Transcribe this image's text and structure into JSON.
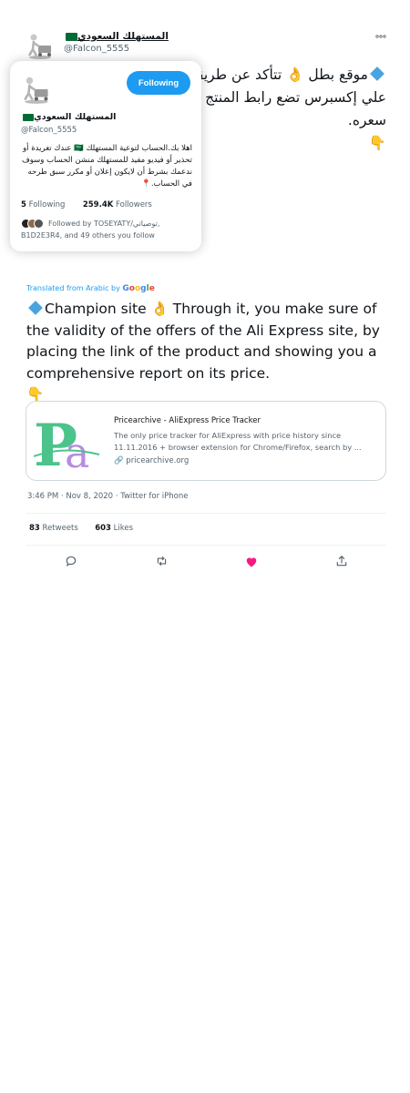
{
  "tweet": {
    "author_name": "المستهلك السعودي",
    "author_handle": "@Falcon_5555",
    "more_icon": "more-horizontal-icon",
    "text_ar_line1": "موقع بطل 👌 تتأكد عن طريقه من صحة عروض موقع",
    "text_ar_line2": "علي إكسبرس تضع رابط المنتج ويعطيك تقرير شامل عن",
    "text_ar_line3": "سعره.",
    "text_ar_emoji": "👇",
    "translated_label": "Translated from Arabic by",
    "translated_provider": "Google",
    "text_en": "Champion site 👌 Through it, you make sure of the validity of the offers of the Ali Express site, by placing the link of the product and showing you a comprehensive report on its price.",
    "text_en_emoji": "👇",
    "timestamp": "3:46 PM · Nov 8, 2020 · Twitter for iPhone",
    "retweets_count": "83",
    "retweets_label": "Retweets",
    "likes_count": "603",
    "likes_label": "Likes"
  },
  "hover_card": {
    "follow_button": "Following",
    "name": "المستهلك السعودي",
    "handle": "@Falcon_5555",
    "bio": "اهلا بك.الحساب لتوعية المستهلك 🇸🇦 عندك تغريدة أو تحذير أو فيديو مفيد للمستهلك منشن الحساب وسوف ندعمك بشرط أن لايكون إعلان أو مكرر سبق طرحه في الحساب.📍",
    "following_count": "5",
    "following_label": "Following",
    "followers_count": "259.4K",
    "followers_label": "Followers",
    "followed_by": "Followed by TOSEYATY/توصياتي, B1D2E3R4, and 49 others you follow"
  },
  "link_card": {
    "title": "Pricearchive - AliExpress Price Tracker",
    "description": "The only price tracker for AliExpress with price history since 11.11.2016 + browser extension for Chrome/Firefox, search by ...",
    "domain": "pricearchive.org",
    "thumb_text": "Pa",
    "thumb_colors": [
      "#4cc38a",
      "#b98be0"
    ]
  },
  "actions": {
    "reply_icon": "reply-icon",
    "retweet_icon": "retweet-icon",
    "like_icon": "heart-filled-icon",
    "share_icon": "share-icon",
    "like_color": "#f91880"
  },
  "colors": {
    "accent": "#1d9bf0",
    "text": "#0f1419",
    "muted": "#536471"
  }
}
